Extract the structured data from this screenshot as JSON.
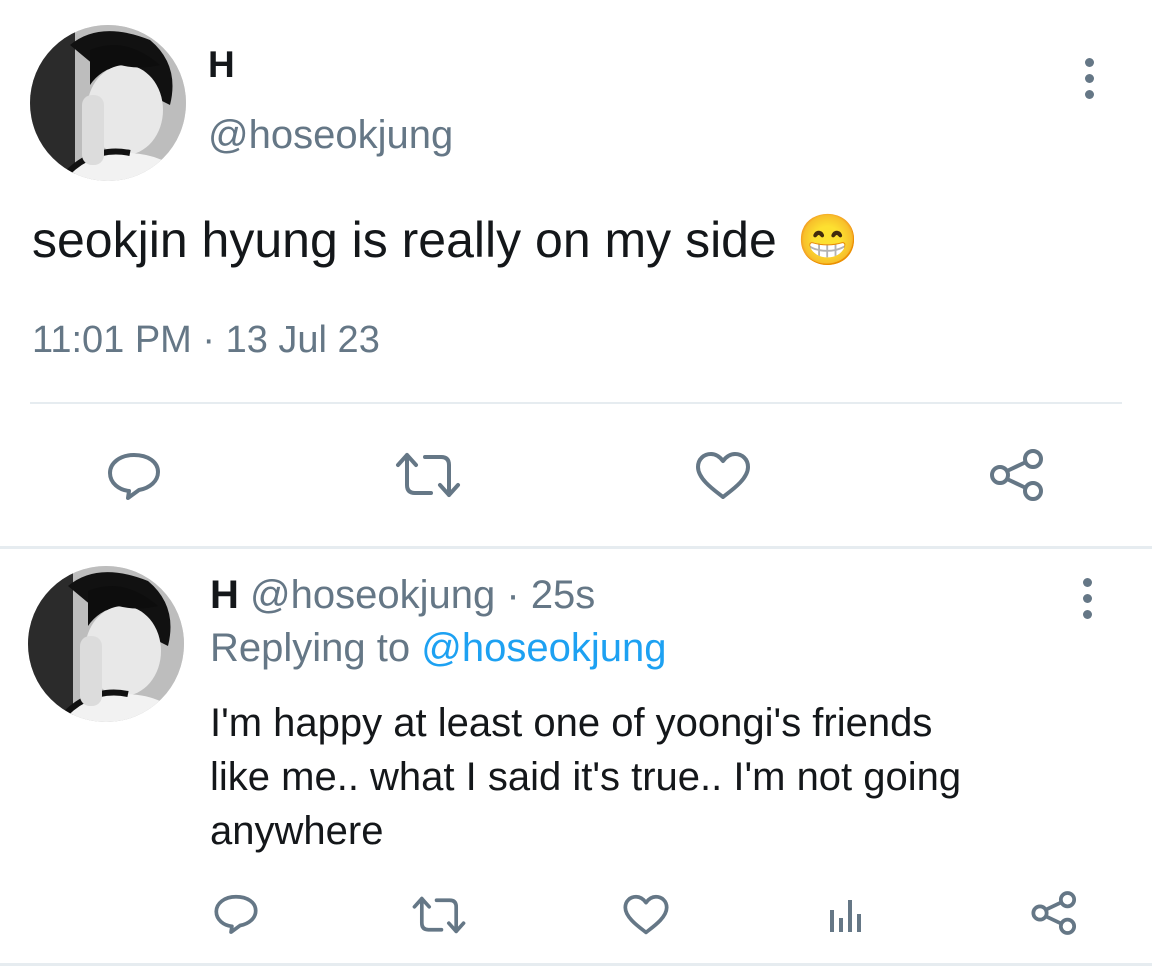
{
  "main_tweet": {
    "display_name": "H",
    "handle": "@hoseokjung",
    "text": "seokjin hyung is really on my side",
    "emoji": "😁",
    "timestamp": "11:01 PM · 13 Jul 23",
    "actions": [
      "reply-icon",
      "retweet-icon",
      "like-icon",
      "share-icon"
    ]
  },
  "reply_tweet": {
    "display_name": "H",
    "handle": "@hoseokjung",
    "separator": "·",
    "age": "25s",
    "replying_prefix": "Replying to",
    "replying_handle": "@hoseokjung",
    "text_lines": [
      "I'm happy at least one of yoongi's friends",
      "like me.. what I said it's true.. I'm not going",
      "anywhere"
    ],
    "actions": [
      "reply-icon",
      "retweet-icon",
      "like-icon",
      "analytics-icon",
      "share-icon"
    ]
  },
  "colors": {
    "text": "#14171a",
    "muted": "#657786",
    "link": "#1da1f2",
    "divider": "#e6ecf0"
  }
}
